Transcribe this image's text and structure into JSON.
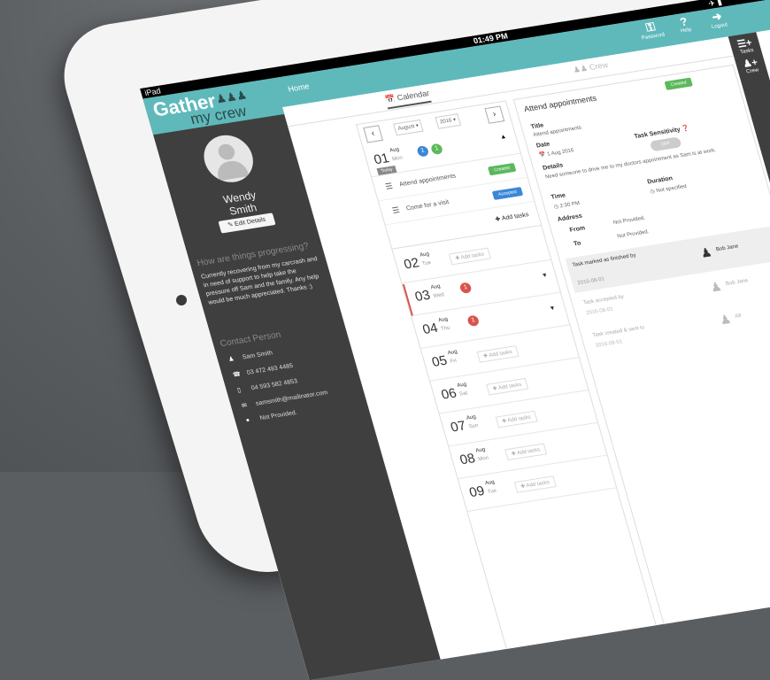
{
  "status_bar": {
    "carrier": "iPad",
    "time": "01:49 PM",
    "battery": "✈ ▮"
  },
  "sidebar": {
    "logo_line1": "Gather",
    "logo_line2": "my crew",
    "first_name": "Wendy",
    "last_name": "Smith",
    "edit_label": "Edit Details",
    "progress_title": "How are things progressing?",
    "progress_text": "Currently recovering from my carcrash and in need of support to help take the pressure off Sam and the family. Any help would be much appreciated. Thanks :)",
    "contact_title": "Contact Person",
    "contacts": [
      {
        "icon": "person-icon",
        "text": "Sam Smith"
      },
      {
        "icon": "phone-icon",
        "text": "03 472 493 4485"
      },
      {
        "icon": "mobile-icon",
        "text": "04 593 582 4853"
      },
      {
        "icon": "email-icon",
        "text": "samsmith@mailinator.com"
      },
      {
        "icon": "location-icon",
        "text": "Not Provided."
      }
    ]
  },
  "header": {
    "home_label": "Home",
    "actions": [
      {
        "label": "Password",
        "icon": "key-icon"
      },
      {
        "label": "Help",
        "icon": "help-icon"
      },
      {
        "label": "Logout",
        "icon": "logout-icon"
      }
    ]
  },
  "rail": [
    {
      "label": "Tasks",
      "icon": "tasks-icon"
    },
    {
      "label": "Crew",
      "icon": "crew-icon"
    }
  ],
  "tabs": [
    {
      "label": "Calendar",
      "active": true
    },
    {
      "label": "Crew",
      "active": false
    }
  ],
  "calendar": {
    "month": "August",
    "year": "2016",
    "today_label": "Today",
    "add_tasks_label": "Add tasks",
    "first_day": {
      "num": "01",
      "month": "Aug",
      "weekday": "Mon",
      "badges": [
        "1",
        "1"
      ]
    },
    "tasks": [
      {
        "name": "Attend appointments",
        "status": "Created",
        "color": "#5cb85c"
      },
      {
        "name": "Come for a visit",
        "status": "Accepted",
        "color": "#3a87d6"
      }
    ],
    "days": [
      {
        "num": "02",
        "month": "Aug",
        "weekday": "Tue",
        "badge": ""
      },
      {
        "num": "03",
        "month": "Aug",
        "weekday": "Wed",
        "badge": "1"
      },
      {
        "num": "04",
        "month": "Aug",
        "weekday": "Thu",
        "badge": "1"
      },
      {
        "num": "05",
        "month": "Aug",
        "weekday": "Fri",
        "badge": ""
      },
      {
        "num": "06",
        "month": "Aug",
        "weekday": "Sat",
        "badge": ""
      },
      {
        "num": "07",
        "month": "Aug",
        "weekday": "Sun",
        "badge": ""
      },
      {
        "num": "08",
        "month": "Aug",
        "weekday": "Mon",
        "badge": ""
      },
      {
        "num": "09",
        "month": "Aug",
        "weekday": "Tue",
        "badge": ""
      }
    ]
  },
  "detail": {
    "title": "Attend appointments",
    "status": "Created",
    "title_label": "Title",
    "title_value": "Attend appointments",
    "date_label": "Date",
    "date_value": "1 Aug 2016",
    "sensitivity_label": "Task Sensitivity",
    "sensitivity_value": "OFF",
    "details_label": "Details",
    "details_value": "Need someone to drive me to my doctors appointment as Sam is at work.",
    "time_label": "Time",
    "time_value": "2:30 PM",
    "duration_label": "Duration",
    "duration_value": "Not specified",
    "address_label": "Address",
    "from_label": "From",
    "from_value": "Not Provided.",
    "to_label": "To",
    "to_value": "Not Provided.",
    "history": [
      {
        "text": "Task marked as finished by",
        "date": "2016-08-01",
        "person": "Bob Jane"
      },
      {
        "text": "Task accepted by",
        "date": "2016-08-01",
        "person": "Bob Jane"
      },
      {
        "text": "Task created & sent to",
        "date": "2016-08-01",
        "person": "All"
      }
    ]
  },
  "colors": {
    "accent": "#5fb9bb",
    "sidebar": "#3f3f3f",
    "created": "#5cb85c",
    "accepted": "#3a87d6",
    "badge_blue": "#3a87d6",
    "badge_green": "#5cb85c",
    "badge_red": "#d9534f"
  }
}
